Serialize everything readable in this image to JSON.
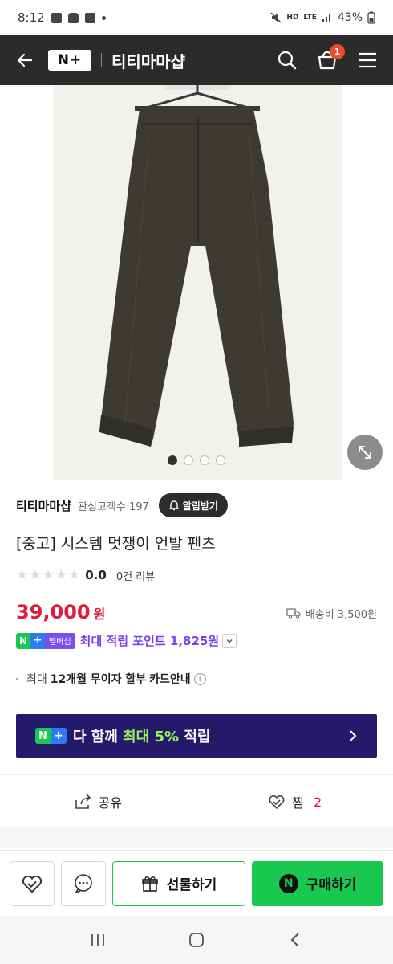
{
  "status_bar": {
    "time": "8:12",
    "battery": "43%",
    "network_hd": "HD",
    "network_lte": "LTE"
  },
  "header": {
    "logo_text": "N+",
    "store_name": "티티마마샵",
    "cart_count": "1"
  },
  "gallery": {
    "page_count": 4,
    "active_page": 1
  },
  "store": {
    "name": "티티마마샵",
    "followers_label": "관심고객수 197",
    "alarm_label": "알림받기"
  },
  "product": {
    "title": "[중고] 시스템 멋쟁이 언발 팬츠",
    "rating": "0.0",
    "review_count": "0건 리뷰",
    "price": "39,000",
    "price_unit": "원",
    "shipping": "배송비 3,500원"
  },
  "points": {
    "badge_n": "N",
    "badge_plus": "+",
    "badge_member": "멤버십",
    "text": "최대 적립 포인트 1,825원"
  },
  "installment": {
    "prefix": "최대",
    "bold": "12개월 무이자 할부",
    "suffix": "카드안내"
  },
  "promo": {
    "text_before": "다 함께",
    "text_highlight": "최대 5%",
    "text_after": "적립"
  },
  "actions": {
    "share_label": "공유",
    "wish_label": "찜",
    "wish_count": "2"
  },
  "bottom": {
    "gift_label": "선물하기",
    "buy_label": "구매하기"
  },
  "colors": {
    "price_red": "#e31b3b",
    "naver_green": "#18c84f",
    "point_purple": "#7c3fee",
    "promo_bg": "#25196b",
    "header_bg": "#2b2b2b"
  }
}
